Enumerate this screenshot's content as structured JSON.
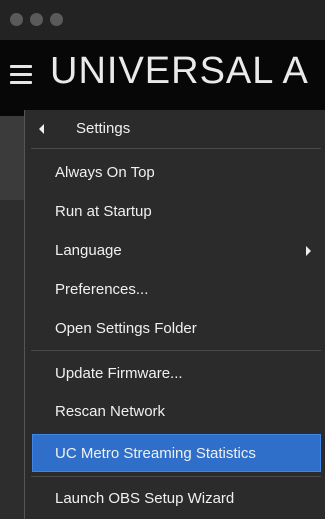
{
  "app": {
    "brand_text": "UNIVERSAL A"
  },
  "menu": {
    "header": {
      "label": "Settings"
    },
    "items": [
      {
        "label": "Always On Top"
      },
      {
        "label": "Run at Startup"
      },
      {
        "label": "Language"
      },
      {
        "label": "Preferences..."
      },
      {
        "label": "Open Settings Folder"
      },
      {
        "label": "Update Firmware..."
      },
      {
        "label": "Rescan Network"
      },
      {
        "label": "UC Metro Streaming Statistics"
      },
      {
        "label": "Launch OBS Setup Wizard"
      }
    ]
  },
  "colors": {
    "selected": "#2f6fc9",
    "menu_bg": "#2b2b2b"
  },
  "icons": [
    "back-arrow-icon",
    "submenu-arrow-icon",
    "hamburger-menu-icon"
  ]
}
